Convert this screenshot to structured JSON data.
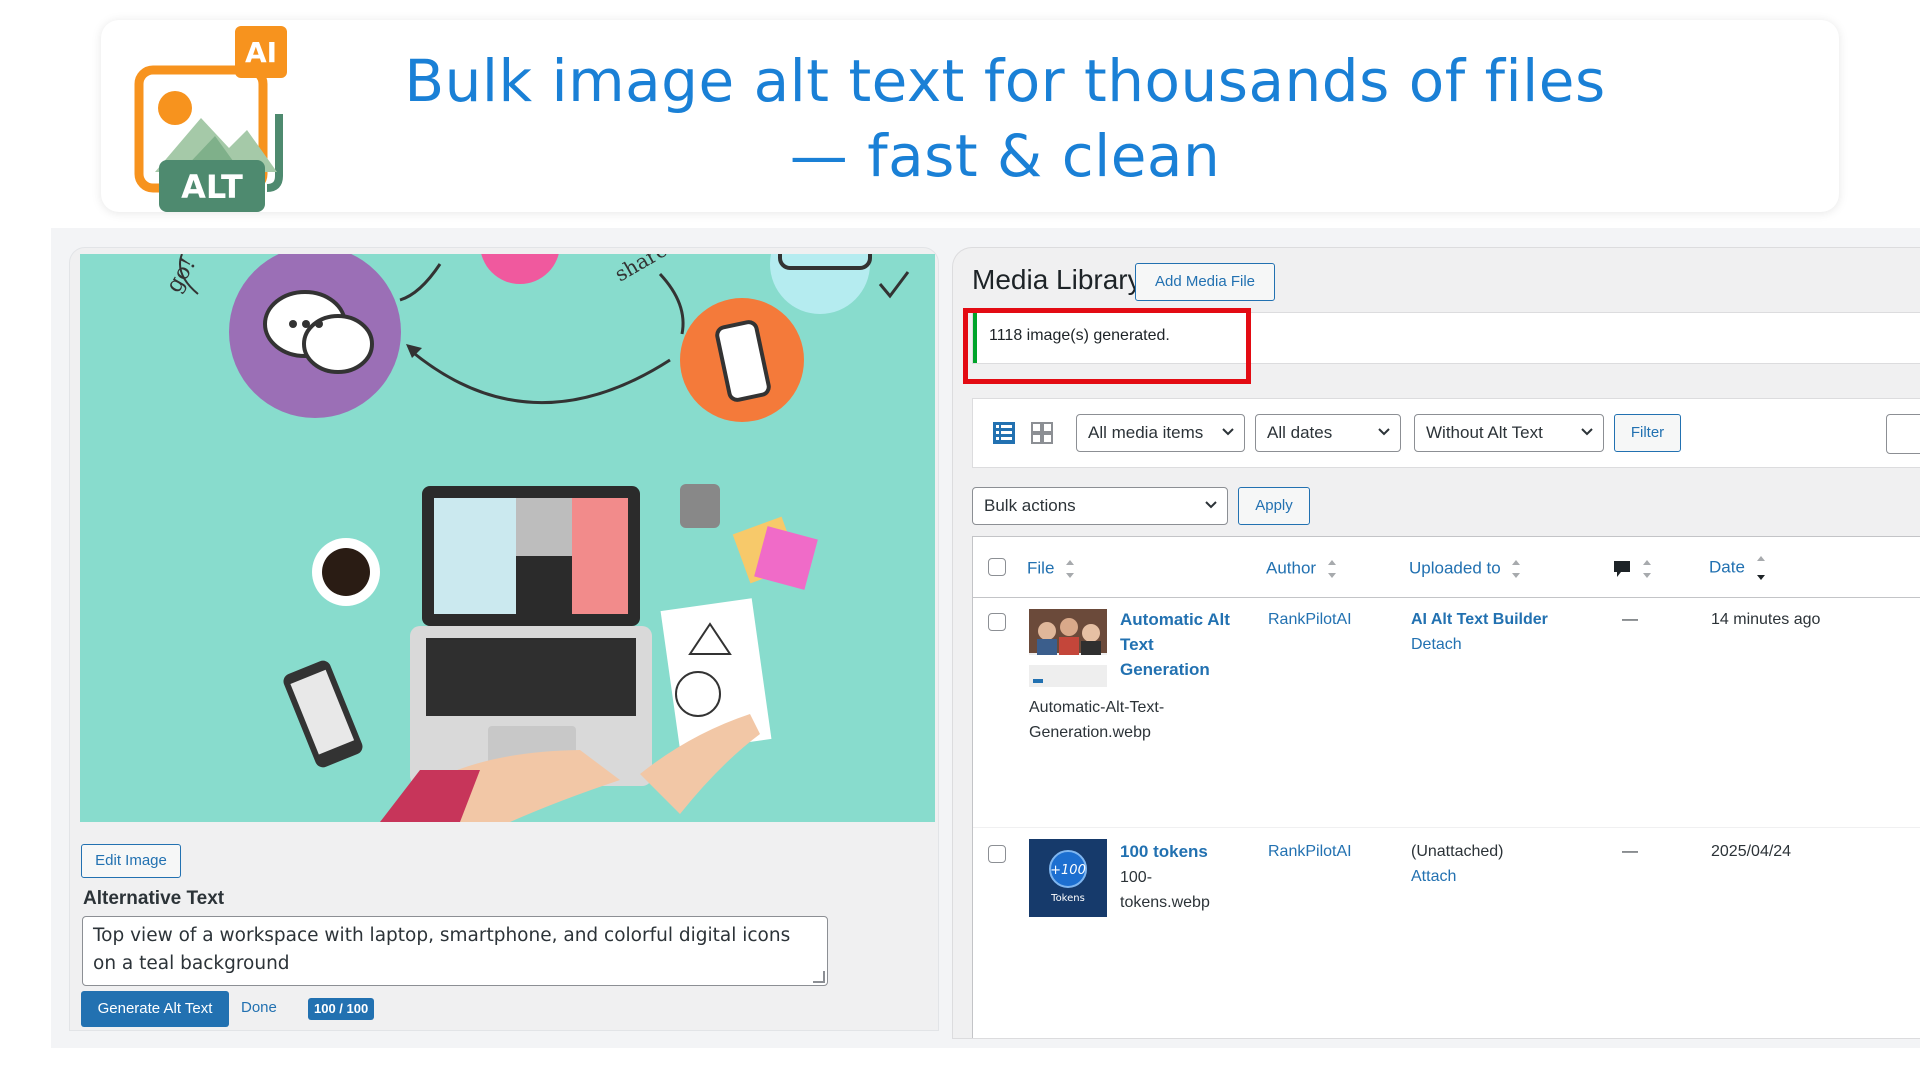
{
  "banner": {
    "logo": {
      "badge_top": "AI",
      "badge_bottom": "ALT"
    },
    "headline_line1": "Bulk image alt text for thousands of files",
    "headline_line2": "— fast & clean"
  },
  "editor": {
    "edit_image_label": "Edit Image",
    "alt_text_label": "Alternative Text",
    "alt_text_value": "Top view of a workspace with laptop, smartphone, and colorful digital icons on a teal background",
    "generate_label": "Generate Alt Text",
    "done_label": "Done",
    "count_badge": "100 / 100"
  },
  "library": {
    "title": "Media Library",
    "add_media_label": "Add Media File",
    "notice": "1118 image(s) generated.",
    "filters": {
      "media_type": "All media items",
      "dates": "All dates",
      "alt_filter": "Without Alt Text",
      "filter_label": "Filter"
    },
    "bulk": {
      "actions": "Bulk actions",
      "apply_label": "Apply"
    },
    "columns": {
      "file": "File",
      "author": "Author",
      "uploaded_to": "Uploaded to",
      "date": "Date"
    },
    "rows": [
      {
        "title_l1": "Automatic Alt",
        "title_l2": "Text",
        "title_l3": "Generation",
        "filename_l1": "Automatic-Alt-Text-",
        "filename_l2": "Generation.webp",
        "author": "RankPilotAI",
        "uploaded_to": "AI Alt Text Builder",
        "uploaded_action": "Detach",
        "comments": "—",
        "date": "14 minutes ago"
      },
      {
        "title_l1": "100 tokens",
        "filename_l1": "100-",
        "filename_l2": "tokens.webp",
        "thumb_value": "+100",
        "thumb_label": "Tokens",
        "author": "RankPilotAI",
        "uploaded_to": "(Unattached)",
        "uploaded_action": "Attach",
        "comments": "—",
        "date": "2025/04/24"
      }
    ]
  },
  "colors": {
    "headline": "#1a80d6",
    "wp_blue": "#2271b1",
    "notice_green": "#00a32a",
    "highlight_red": "#e30b13",
    "photo_teal": "#88dccd",
    "logo_orange": "#f7931e",
    "logo_green": "#4e8a6f"
  }
}
